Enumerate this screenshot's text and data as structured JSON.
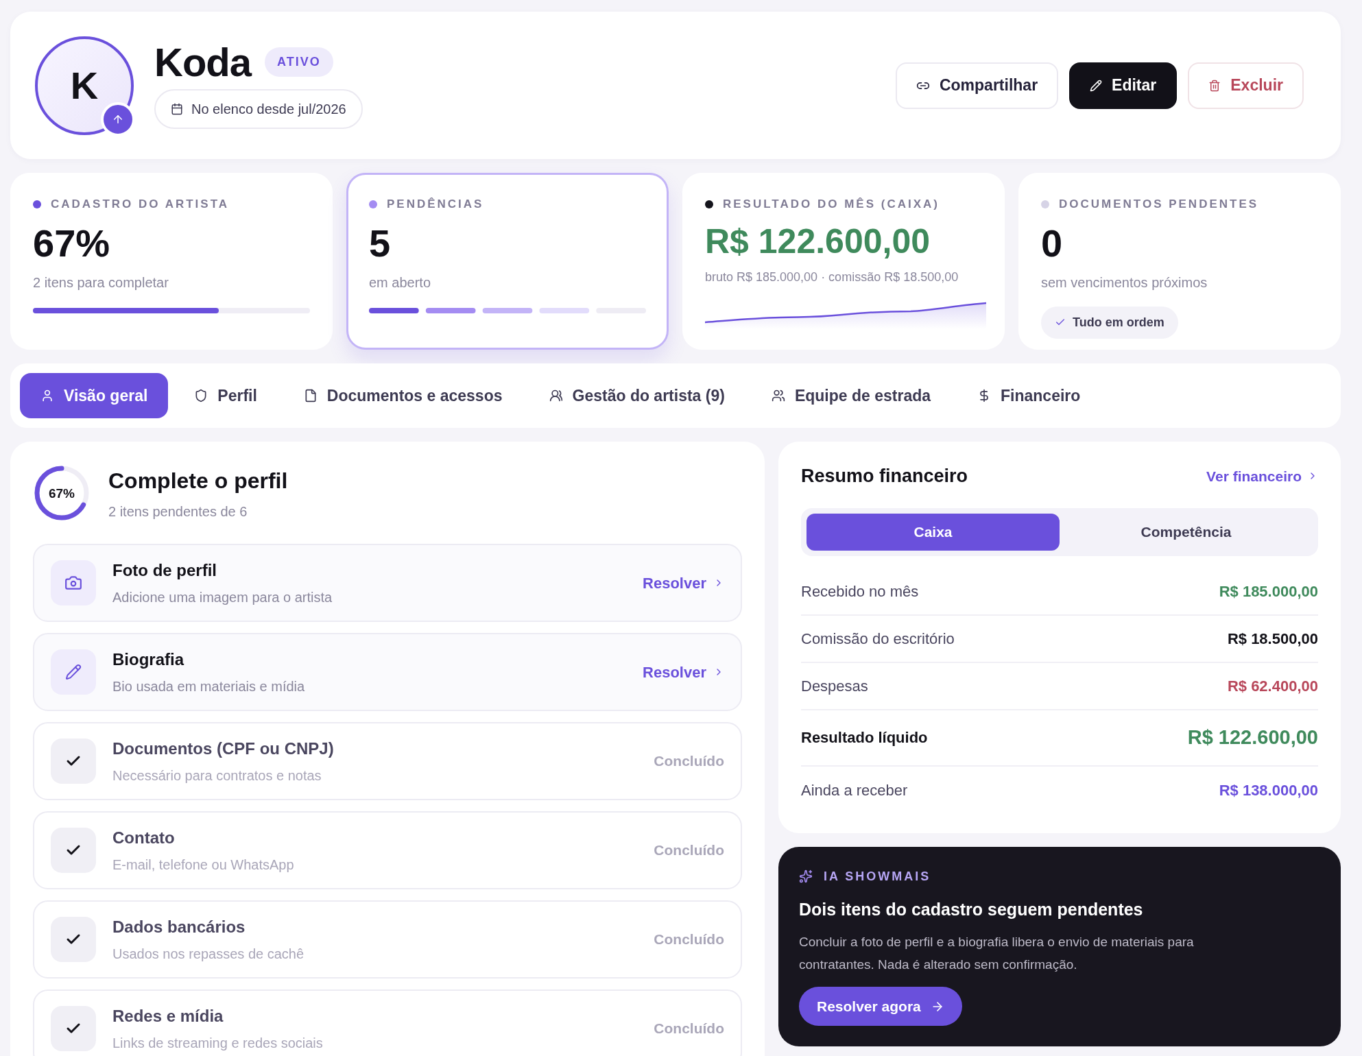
{
  "header": {
    "avatar_initial": "K",
    "name": "Koda",
    "status": "ATIVO",
    "since": "No elenco desde jul/2026",
    "actions": [
      {
        "label": "Compartilhar",
        "kind": "outline"
      },
      {
        "label": "Editar",
        "kind": "primary"
      },
      {
        "label": "Excluir",
        "kind": "danger"
      }
    ]
  },
  "stats": [
    {
      "kind": "progress",
      "label": "CADASTRO DO ARTISTA",
      "color": "#6a50dc",
      "value": "67%",
      "sub": "2 itens para completar",
      "level": 0.67,
      "selected": false
    },
    {
      "kind": "segments",
      "label": "PENDÊNCIAS",
      "color": "#a48cf2",
      "value": "5",
      "sub": "em aberto",
      "selected": true
    },
    {
      "kind": "sparkline",
      "label": "RESULTADO DO MÊS (CAIXA)",
      "color": "#15141c",
      "value": "R$ 122.600,00",
      "sub": "bruto R$ 185.000,00 · comissão R$ 18.500,00",
      "selected": false
    },
    {
      "kind": "badge",
      "label": "DOCUMENTOS PENDENTES",
      "color": "#d6d3e6",
      "value": "0",
      "sub": "sem vencimentos próximos",
      "badge": "Tudo em ordem",
      "selected": false
    }
  ],
  "tabs": [
    {
      "label": "Visão geral",
      "selected": true
    },
    {
      "label": "Perfil",
      "selected": false
    },
    {
      "label": "Documentos e acessos",
      "selected": false
    },
    {
      "label": "Gestão do artista (9)",
      "selected": false
    },
    {
      "label": "Equipe de estrada",
      "selected": false
    },
    {
      "label": "Financeiro",
      "selected": false
    }
  ],
  "profile": {
    "ring_label": "67%",
    "level": 0.67,
    "title": "Complete o perfil",
    "sub": "2 itens pendentes de 6",
    "items": [
      {
        "title": "Foto de perfil",
        "sub": "Adicione uma imagem para o artista",
        "done": false,
        "kind": "camera",
        "action": "Resolver"
      },
      {
        "title": "Biografia",
        "sub": "Bio usada em materiais e mídia",
        "done": false,
        "kind": "pencil",
        "action": "Resolver"
      },
      {
        "title": "Documentos (CPF ou CNPJ)",
        "sub": "Necessário para contratos e notas",
        "done": true,
        "kind": "check",
        "action": "Concluído"
      },
      {
        "title": "Contato",
        "sub": "E-mail, telefone ou WhatsApp",
        "done": true,
        "kind": "check",
        "action": "Concluído"
      },
      {
        "title": "Dados bancários",
        "sub": "Usados nos repasses de cachê",
        "done": true,
        "kind": "check",
        "action": "Concluído"
      },
      {
        "title": "Redes e mídia",
        "sub": "Links de streaming e redes sociais",
        "done": true,
        "kind": "check",
        "action": "Concluído"
      }
    ]
  },
  "finance": {
    "title": "Resumo financeiro",
    "link": "Ver financeiro",
    "modes": [
      {
        "label": "Caixa",
        "selected": true
      },
      {
        "label": "Competência",
        "selected": false
      }
    ],
    "rows": [
      {
        "label": "Recebido no mês",
        "value": "R$ 185.000,00",
        "kind": "positive"
      },
      {
        "label": "Comissão do escritório",
        "value": "R$ 18.500,00",
        "kind": "neutral"
      },
      {
        "label": "Despesas",
        "value": "R$ 62.400,00",
        "kind": "negative"
      },
      {
        "label": "Resultado líquido",
        "value": "R$ 122.600,00",
        "kind": "total"
      },
      {
        "label": "Ainda a receber",
        "value": "R$ 138.000,00",
        "kind": "pending"
      }
    ]
  },
  "ai": {
    "label": "IA SHOWMAIS",
    "title": "Dois itens do cadastro seguem pendentes",
    "text": "Concluir a foto de perfil e a biografia libera o envio de materiais para contratantes. Nada é alterado sem confirmação.",
    "button": "Resolver agora"
  }
}
